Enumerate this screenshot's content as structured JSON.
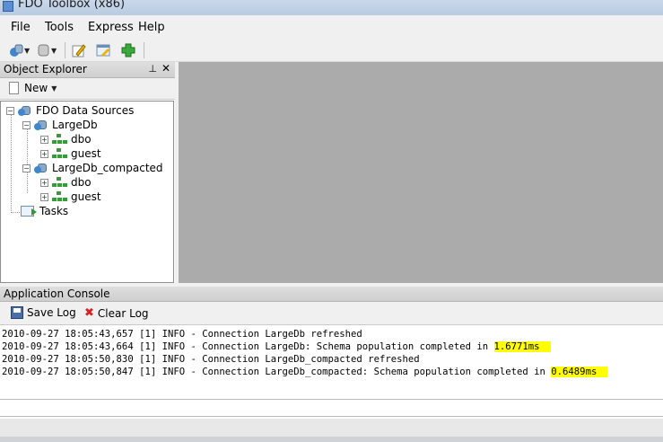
{
  "window": {
    "title": "FDO Toolbox (x86)"
  },
  "menu": [
    "File",
    "Tools",
    "Express",
    "Help"
  ],
  "toolbar": {
    "icons": [
      "connect-icon",
      "database-icon",
      "edit-icon",
      "form-icon",
      "addin-icon"
    ]
  },
  "object_explorer": {
    "title": "Object Explorer",
    "new_label": "New",
    "tree": {
      "root": "FDO Data Sources",
      "connections": [
        {
          "name": "LargeDb",
          "schemas": [
            "dbo",
            "guest"
          ]
        },
        {
          "name": "LargeDb_compacted",
          "schemas": [
            "dbo",
            "guest"
          ]
        }
      ],
      "tasks": "Tasks"
    }
  },
  "console": {
    "title": "Application Console",
    "save_label": "Save Log",
    "clear_label": "Clear Log",
    "lines": [
      {
        "text": "2010-09-27 18:05:43,657 [1] INFO - Connection LargeDb refreshed",
        "highlight": ""
      },
      {
        "text": "2010-09-27 18:05:43,664 [1] INFO - Connection LargeDb: Schema population completed in ",
        "highlight": "1.6771ms"
      },
      {
        "text": "2010-09-27 18:05:50,830 [1] INFO - Connection LargeDb_compacted refreshed",
        "highlight": ""
      },
      {
        "text": "2010-09-27 18:05:50,847 [1] INFO - Connection LargeDb_compacted: Schema population completed in ",
        "highlight": "0.6489ms"
      }
    ]
  },
  "colors": {
    "highlight": "#ffff00",
    "document_area": "#ababab"
  }
}
